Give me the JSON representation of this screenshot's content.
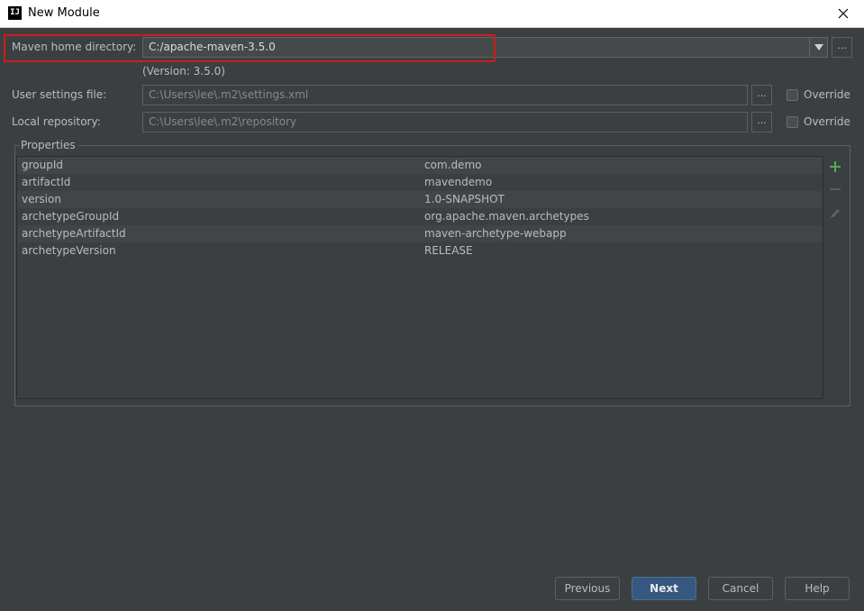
{
  "window": {
    "title": "New Module",
    "app_icon_text": "IJ"
  },
  "maven": {
    "home_label": "Maven home directory:",
    "home_value": "C:/apache-maven-3.5.0",
    "version_text": "(Version: 3.5.0)",
    "settings_label": "User settings file:",
    "settings_value": "C:\\Users\\lee\\.m2\\settings.xml",
    "repo_label": "Local repository:",
    "repo_value": "C:\\Users\\lee\\.m2\\repository",
    "override_label": "Override",
    "browse_label": "..."
  },
  "properties": {
    "title": "Properties",
    "rows": [
      {
        "key": "groupId",
        "value": "com.demo"
      },
      {
        "key": "artifactId",
        "value": "mavendemo"
      },
      {
        "key": "version",
        "value": "1.0-SNAPSHOT"
      },
      {
        "key": "archetypeGroupId",
        "value": "org.apache.maven.archetypes"
      },
      {
        "key": "archetypeArtifactId",
        "value": "maven-archetype-webapp"
      },
      {
        "key": "archetypeVersion",
        "value": "RELEASE"
      }
    ]
  },
  "buttons": {
    "previous": "Previous",
    "next": "Next",
    "cancel": "Cancel",
    "help": "Help"
  },
  "colors": {
    "background": "#3c3f41",
    "highlight": "#cc1d1d",
    "add_icon": "#4caf50",
    "default_button": "#365880"
  }
}
